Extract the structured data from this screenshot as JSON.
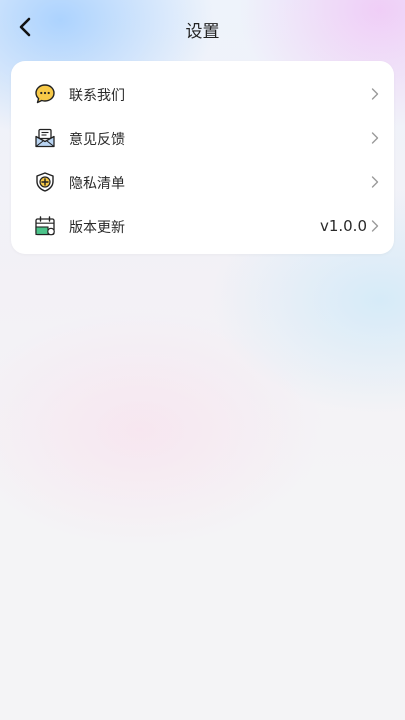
{
  "header": {
    "title": "设置",
    "back_icon": "chevron-left-icon"
  },
  "settings": {
    "items": [
      {
        "label": "联系我们",
        "icon": "chat-bubble-icon",
        "value": ""
      },
      {
        "label": "意见反馈",
        "icon": "envelope-icon",
        "value": ""
      },
      {
        "label": "隐私清单",
        "icon": "shield-plus-icon",
        "value": ""
      },
      {
        "label": "版本更新",
        "icon": "calendar-icon",
        "value": "v1.0.0"
      }
    ]
  },
  "colors": {
    "icon_yellow": "#f7c948",
    "icon_blue": "#b9d4f2",
    "icon_outline": "#222222",
    "chevron": "#999999"
  }
}
